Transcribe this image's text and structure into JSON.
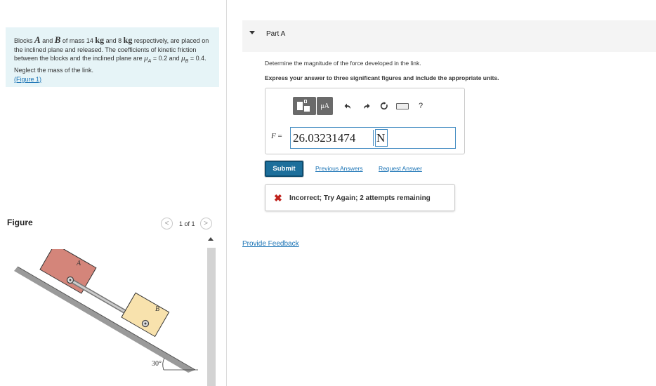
{
  "problem": {
    "p1": "Blocks ",
    "varA": "A",
    "p2": " and ",
    "varB": "B",
    "p3": " of mass 14 ",
    "unit1": "kg",
    "p4": " and 8 ",
    "unit2": "kg",
    "p5": " respectively, are placed on the inclined plane and released. The coefficients of kinetic friction between the blocks and the inclined plane are ",
    "muA": "μ",
    "subA": "A",
    "p6": " = 0.2 and ",
    "muB": "μ",
    "subB": "B",
    "p7": " = 0.4. Neglect the mass of the link.",
    "figure_link": "(Figure 1)"
  },
  "figure_panel": {
    "label": "Figure",
    "pager_text": "1 of 1",
    "prev_icon": "chevron-left-icon",
    "next_icon": "chevron-right-icon",
    "prev_glyph": "<",
    "next_glyph": ">",
    "label_A": "A",
    "label_B": "B",
    "angle": "30°"
  },
  "part": {
    "title": "Part A",
    "instruction": "Determine the magnitude of the force developed in the link.",
    "express": "Express your answer to three significant figures and include the appropriate units."
  },
  "toolbar": {
    "mu_label": "μA",
    "undo_icon": "undo-icon",
    "redo_icon": "redo-icon",
    "reset_icon": "reset-icon",
    "keyboard_icon": "keyboard-icon",
    "help_label": "?"
  },
  "answer": {
    "label_var": "F",
    "label_eq": " =",
    "value": "26.03231474",
    "unit": "N"
  },
  "actions": {
    "submit": "Submit",
    "previous_answers": "Previous Answers",
    "request_answer": "Request Answer"
  },
  "feedback": {
    "icon": "x-icon",
    "glyph": "✖",
    "text": "Incorrect; Try Again; 2 attempts remaining"
  },
  "provide_feedback": "Provide Feedback",
  "colors": {
    "problem_bg": "#e6f4f7",
    "link": "#1a73b5",
    "submit_bg": "#1d6f9b",
    "error": "#c0221c",
    "block_a": "#d4857a",
    "block_b": "#f8e2ad"
  }
}
